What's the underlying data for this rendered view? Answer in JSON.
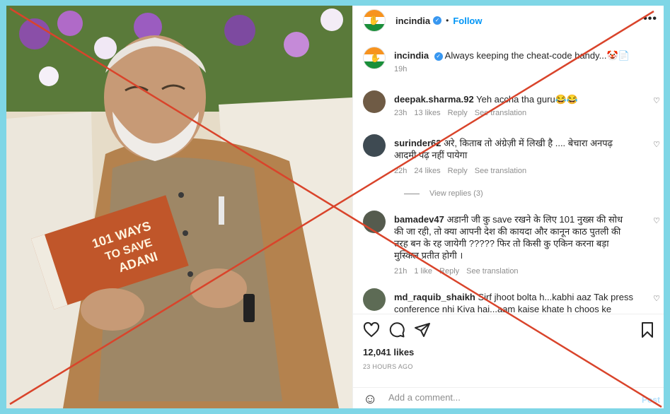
{
  "post": {
    "username": "incindia",
    "follow_label": "Follow",
    "dot": "•",
    "more": "•••",
    "caption_user": "incindia",
    "caption_text": "Always keeping the cheat-code handy...🤡📄",
    "caption_time": "19h",
    "likes": "12,041 likes",
    "posted_ago": "23 HOURS AGO"
  },
  "comments": [
    {
      "user": "deepak.sharma.92",
      "text": "Yeh accha tha guru😂😂",
      "time": "23h",
      "likes": "13 likes",
      "reply": "Reply",
      "translate": "See translation"
    },
    {
      "user": "surinder62",
      "text": "अरे, किताब तो अंग्रेज़ी में लिखी है .... बेचारा अनपढ़ आदमी पढ़ नहीं पायेगा",
      "time": "22h",
      "likes": "24 likes",
      "reply": "Reply",
      "translate": "See translation",
      "view_replies": "View replies (3)"
    },
    {
      "user": "bamadev47",
      "text": "अडानी जी कु save रखने के लिए 101 नुख्स की सोध की जा रही, तो क्या आपनी देश की कायदा और कानून काठ पुतली की तरह बन के रह जायेगी ????? फिर तो किसी कु एकिन करना बड़ा मुस्किल प्रतीत होगी ।",
      "time": "21h",
      "likes": "1 like",
      "reply": "Reply",
      "translate": "See translation"
    },
    {
      "user": "md_raquib_shaikh",
      "text": "Sirf jhoot bolta h...kabhi aaz Tak press conference nhi Kiya hai...aam kaise khate h choos ke khate h.."
    }
  ],
  "add_comment": {
    "placeholder": "Add a comment...",
    "post_label": "Post"
  },
  "photo": {
    "book_line1": "101 WAYS",
    "book_line2": "TO SAVE",
    "book_line3": "ADANI"
  },
  "icons": {
    "heart": "heart-icon",
    "comment": "comment-icon",
    "share": "share-icon",
    "save": "bookmark-icon",
    "emoji": "emoji-icon",
    "more": "more-icon"
  },
  "colors": {
    "background": "#7fd6e6",
    "link": "#0095f6",
    "cross": "#d9442b",
    "muted": "#8e8e8e"
  }
}
